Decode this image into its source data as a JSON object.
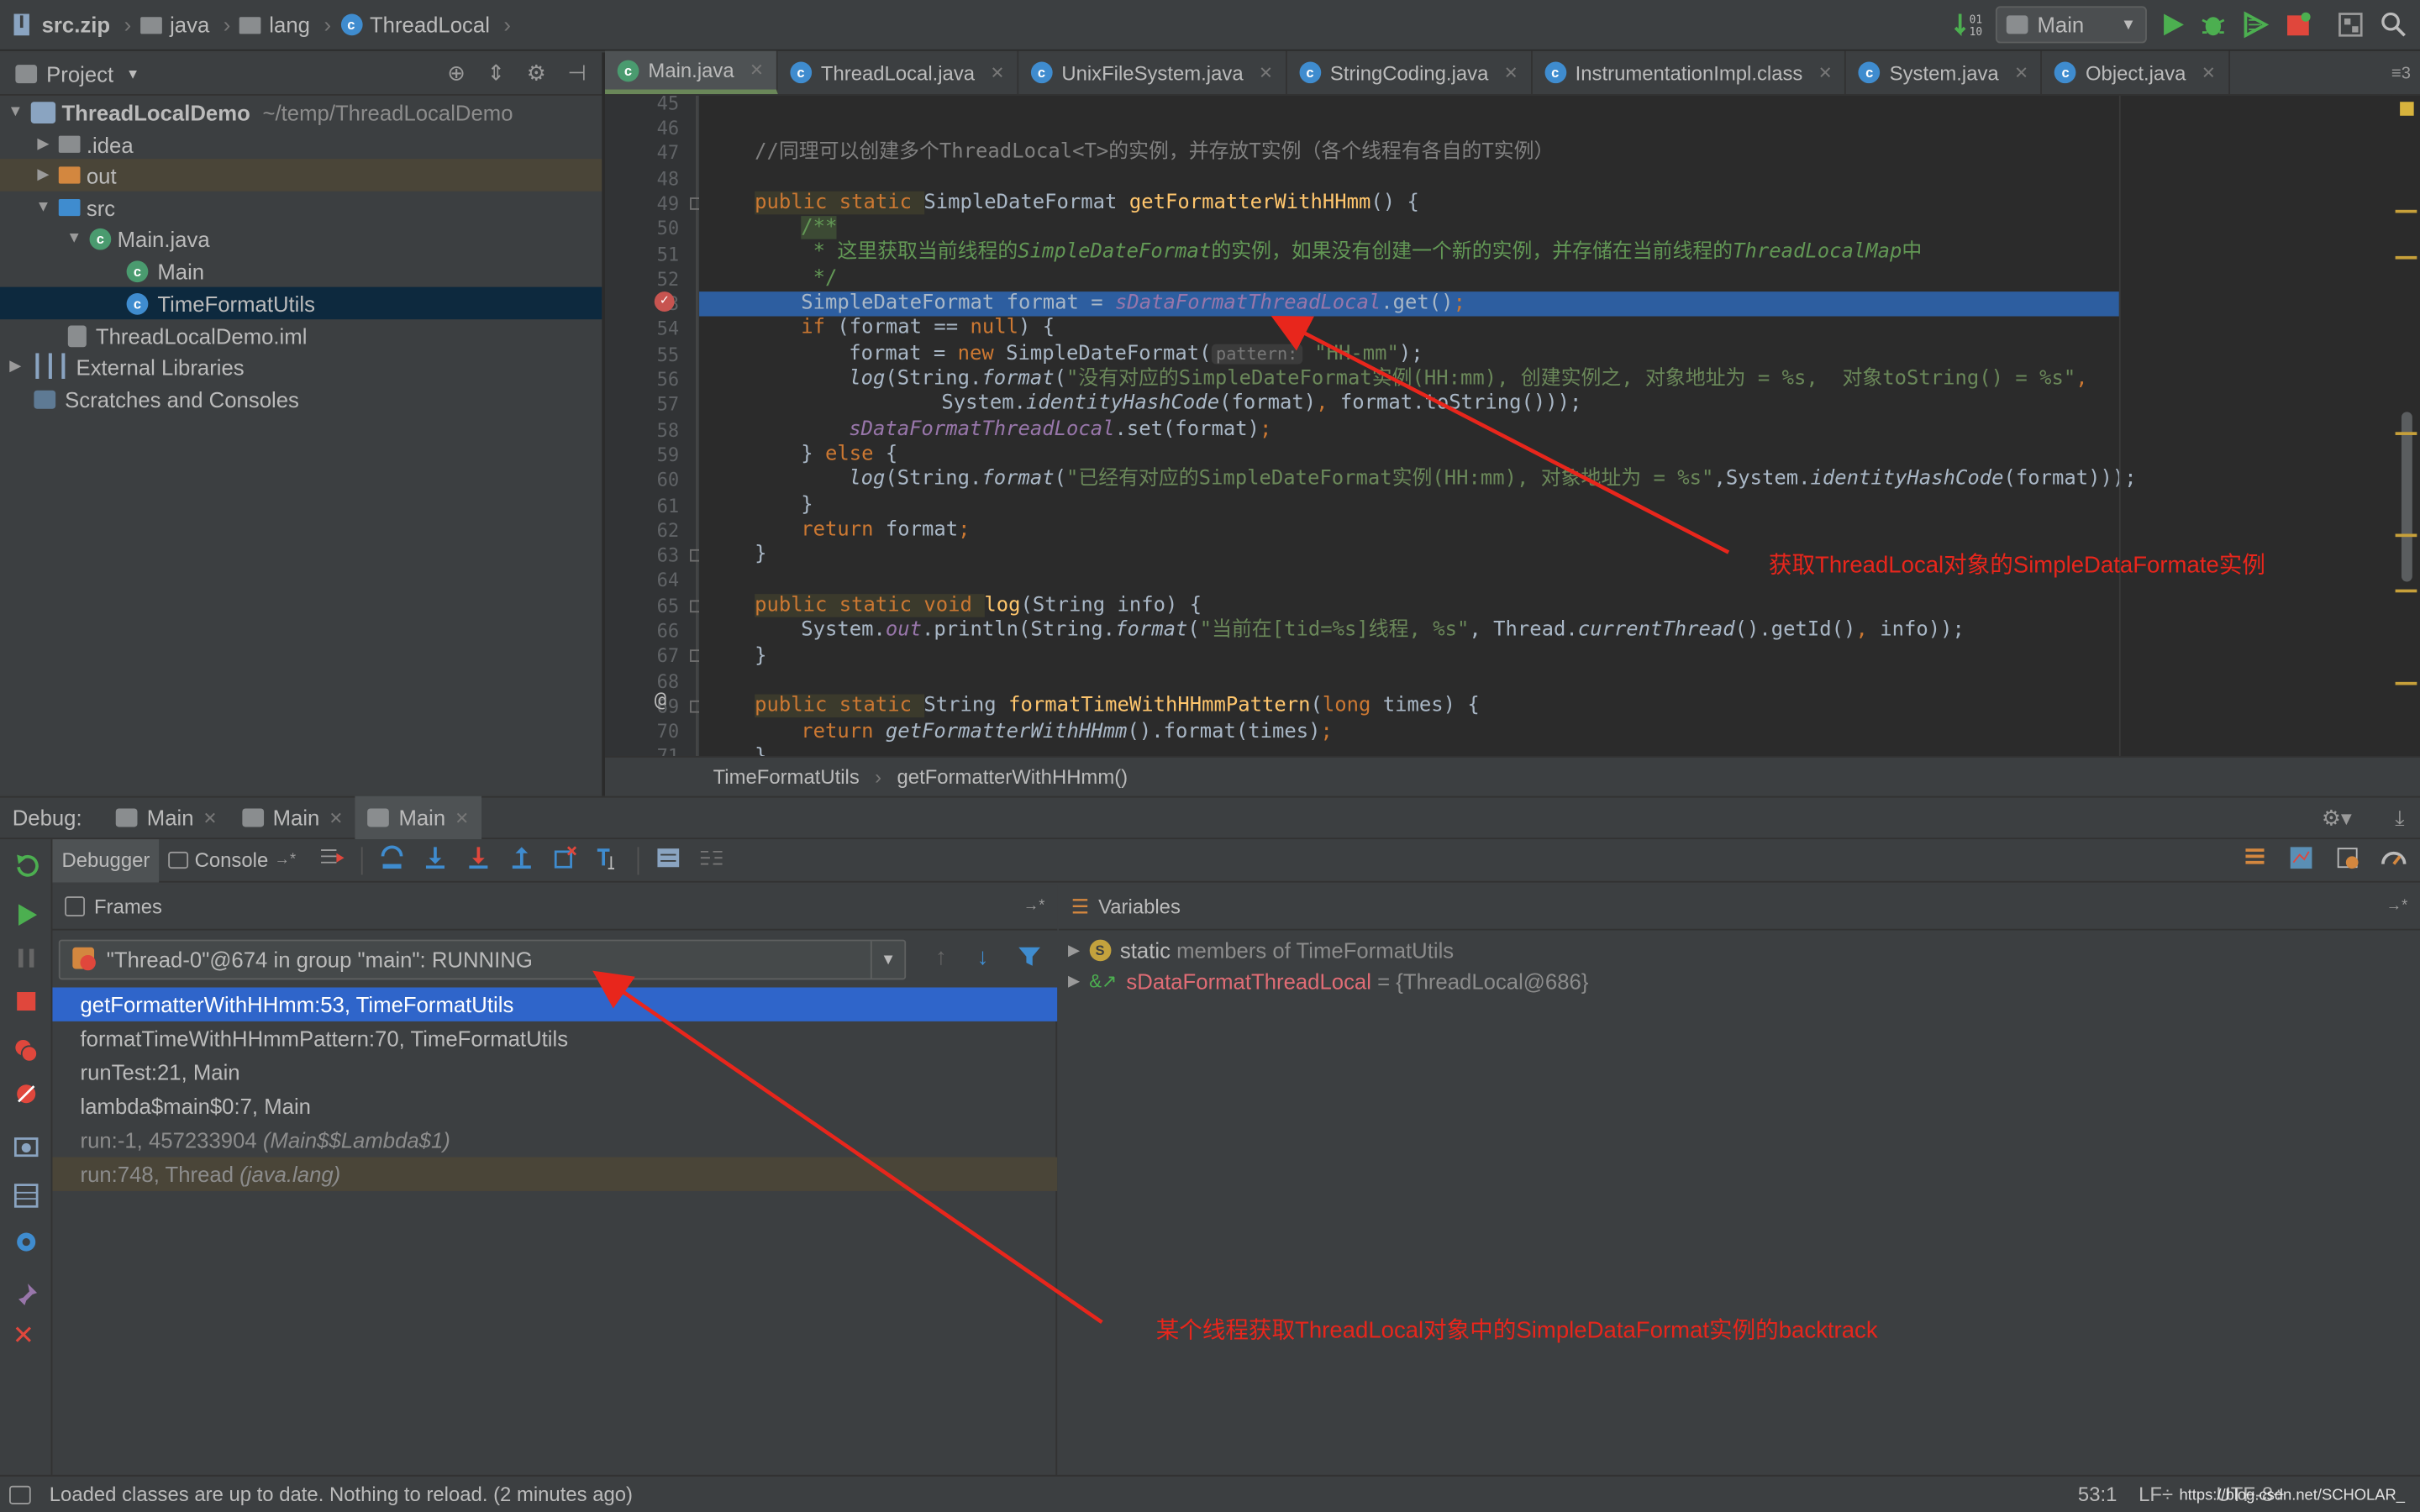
{
  "navbar": {
    "crumbs": [
      "src.zip",
      "java",
      "lang",
      "ThreadLocal"
    ],
    "run_config": "Main"
  },
  "project_panel": {
    "title": "Project",
    "tree": [
      {
        "label": "ThreadLocalDemo",
        "extra": "~/temp/ThreadLocalDemo"
      },
      {
        "label": ".idea"
      },
      {
        "label": "out"
      },
      {
        "label": "src"
      },
      {
        "label": "Main.java"
      },
      {
        "label": "Main"
      },
      {
        "label": "TimeFormatUtils"
      },
      {
        "label": "ThreadLocalDemo.iml"
      },
      {
        "label": "External Libraries"
      },
      {
        "label": "Scratches and Consoles"
      }
    ]
  },
  "editor": {
    "tabs": [
      "Main.java",
      "ThreadLocal.java",
      "UnixFileSystem.java",
      "StringCoding.java",
      "InstrumentationImpl.class",
      "System.java",
      "Object.java"
    ],
    "tabs_overflow": "3",
    "line_numbers": [
      "45",
      "46",
      "47",
      "48",
      "49",
      "50",
      "51",
      "52",
      "53",
      "54",
      "55",
      "56",
      "57",
      "58",
      "59",
      "60",
      "61",
      "62",
      "63",
      "64",
      "65",
      "66",
      "67",
      "68",
      "69",
      "70",
      "71"
    ],
    "code": {
      "l47": "//同理可以创建多个ThreadLocal<T>的实例，并存放T实例（各个线程有各自的T实例）",
      "l49_mod": "public static ",
      "l49_type": "SimpleDateFormat ",
      "l49_fn": "getFormatterWithHHmm",
      "l49_rest": "() {",
      "l50": "/**",
      "l51_a": " * 这里获取当前线程的",
      "l51_b": "SimpleDateFormat",
      "l51_c": "的实例，如果没有创建一个新的实例，并存储在当前线程的",
      "l51_d": "ThreadLocalMap",
      "l51_e": "中",
      "l52": " */",
      "l53_a": "SimpleDateFormat format = ",
      "l53_b": "sDataFormatThreadLocal",
      "l53_c": ".get()",
      "l53_d": ";",
      "l54_a": "if",
      "l54_b": " (format == ",
      "l54_c": "null",
      "l54_d": ") {",
      "l55_a": "format = ",
      "l55_b": "new ",
      "l55_c": "SimpleDateFormat(",
      "l55_hint": "pattern:",
      "l55_d": "\"HH-mm\"",
      "l55_e": ");",
      "l56_a": "log",
      "l56_b": "(String.",
      "l56_c": "format",
      "l56_d": "(",
      "l56_e": "\"没有对应的SimpleDateFormat实例(HH:mm), 创建实例之, 对象地址为 = %s,  对象toString() = %s\"",
      "l56_f": ",",
      "l57_a": "System.",
      "l57_b": "identityHashCode",
      "l57_c": "(format)",
      "l57_d": ", ",
      "l57_e": "format.toString()));",
      "l58_a": "sDataFormatThreadLocal",
      "l58_b": ".set(format)",
      "l58_c": ";",
      "l59_a": "} ",
      "l59_b": "else",
      "l59_c": " {",
      "l60_a": "log",
      "l60_b": "(String.",
      "l60_c": "format",
      "l60_d": "(",
      "l60_e": "\"已经有对应的SimpleDateFormat实例(HH:mm), 对象地址为 = %s\"",
      "l60_f": ",System.",
      "l60_g": "identityHashCode",
      "l60_h": "(format)));",
      "l61": "}",
      "l62_a": "return ",
      "l62_b": "format",
      "l62_c": ";",
      "l63": "}",
      "l65_mod": "public static void ",
      "l65_fn": "log",
      "l65_rest": "(String info) {",
      "l66_a": "System.",
      "l66_b": "out",
      "l66_c": ".println(String.",
      "l66_d": "format",
      "l66_e": "(",
      "l66_f": "\"当前在[tid=%s]线程, %s\"",
      "l66_g": ", Thread.",
      "l66_h": "currentThread",
      "l66_i": "().getId()",
      "l66_j": ", ",
      "l66_k": "info));",
      "l67": "}",
      "l69_mod": "public static ",
      "l69_type": "String ",
      "l69_fn": "formatTimeWithHHmmPattern",
      "l69_b": "(",
      "l69_c": "long ",
      "l69_d": "times) {",
      "l70_a": "return ",
      "l70_b": "getFormatterWithHHmm",
      "l70_c": "().format(times)",
      "l70_d": ";",
      "l71": "}"
    },
    "breadcrumbs": [
      "TimeFormatUtils",
      "getFormatterWithHHmm()"
    ]
  },
  "debug": {
    "label": "Debug:",
    "session_tabs": [
      "Main",
      "Main",
      "Main"
    ],
    "subtabs": [
      "Debugger",
      "Console"
    ],
    "frames_title": "Frames",
    "variables_title": "Variables",
    "thread": "\"Thread-0\"@674 in group \"main\": RUNNING",
    "frames": [
      {
        "text": "getFormatterWithHHmm:53, TimeFormatUtils",
        "pkg": ""
      },
      {
        "text": "formatTimeWithHHmmPattern:70, TimeFormatUtils",
        "pkg": ""
      },
      {
        "text": "runTest:21, Main",
        "pkg": ""
      },
      {
        "text": "lambda$main$0:7, Main",
        "pkg": ""
      },
      {
        "text": "run:-1, 457233904 ",
        "pkg": "(Main$$Lambda$1)"
      },
      {
        "text": "run:748, Thread ",
        "pkg": "(java.lang)"
      }
    ],
    "variables": [
      {
        "prefix": "static",
        "name": " members of TimeFormatUtils",
        "value": ""
      },
      {
        "prefix": "",
        "name": "sDataFormatThreadLocal",
        "value": " = {ThreadLocal@686}"
      }
    ]
  },
  "annotations": {
    "editor_note": "获取ThreadLocal对象的SimpleDataFormate实例",
    "frames_note": "某个线程获取ThreadLocal对象中的SimpleDataFormat实例的backtrack"
  },
  "status": {
    "message": "Loaded classes are up to date. Nothing to reload. (2 minutes ago)",
    "position": "53:1",
    "line_sep": "LF÷",
    "encoding": "UTF-8÷",
    "watermark": "https://blog.csdn.net/SCHOLAR_"
  },
  "colors": {
    "accent": "#2f65ca",
    "exec_line": "#2d5ea0",
    "annotation": "#e8261c",
    "run_green": "#4caf50",
    "stop_red": "#e0473c"
  }
}
